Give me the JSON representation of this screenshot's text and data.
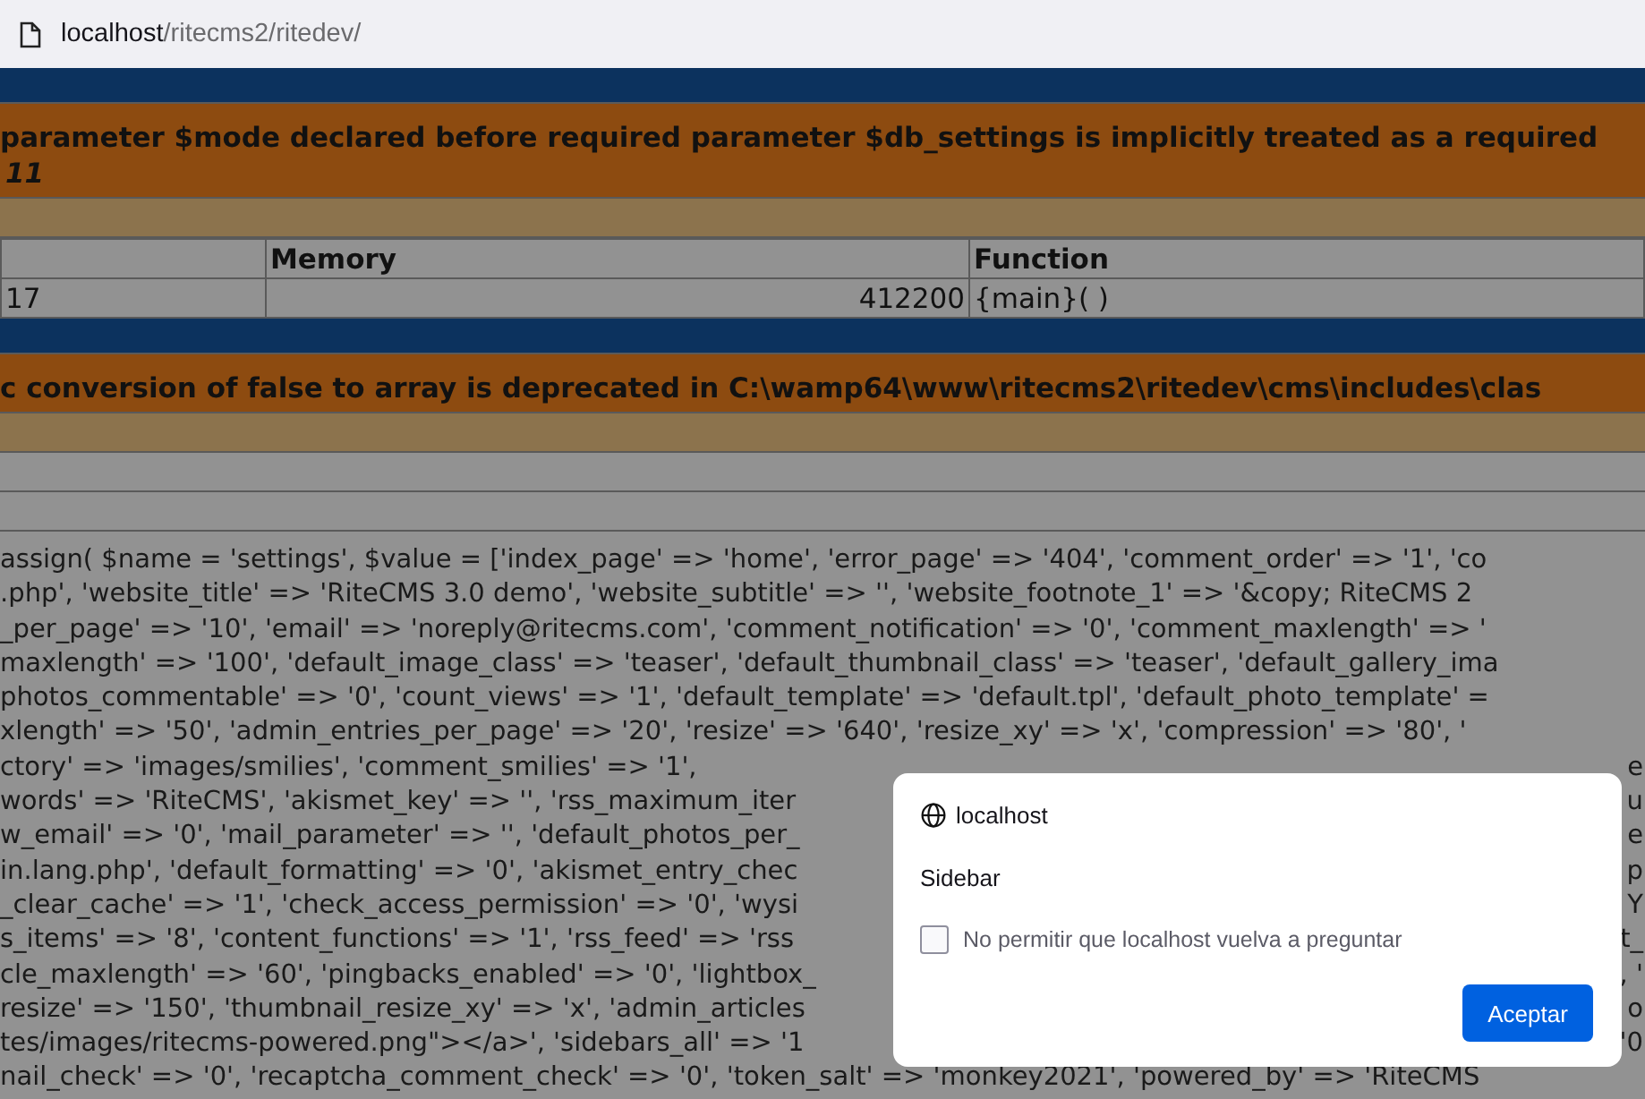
{
  "address_bar": {
    "host": "localhost",
    "path": "/ritecms2/ritedev/"
  },
  "errors": [
    {
      "message": "parameter $mode declared before required parameter $db_settings is implicitly treated as a required",
      "line_2": "11",
      "table": {
        "columns": [
          "Memory",
          "Function"
        ],
        "rows": [
          {
            "column_1": "17",
            "memory": "412200",
            "function": "{main}( )"
          }
        ]
      }
    },
    {
      "message": "c conversion of false to array is deprecated in C:\\wamp64\\www\\ritecms2\\ritedev\\cms\\includes\\clas"
    }
  ],
  "code_lines": [
    {
      "text": "assign( $name = 'settings', $value = ['index_page' => 'home', 'error_page' => '404', 'comment_order' => '1', 'co"
    },
    {
      "text": ".php', 'website_title' => 'RiteCMS 3.0 demo', 'website_subtitle' => '', 'website_footnote_1' => '&copy; RiteCMS 2"
    },
    {
      "text": "_per_page' => '10', 'email' => 'noreply@ritecms.com', 'comment_notification' => '0', 'comment_maxlength' => '"
    },
    {
      "text": "maxlength' => '100', 'default_image_class' => 'teaser', 'default_thumbnail_class' => 'teaser', 'default_gallery_ima"
    },
    {
      "text": "photos_commentable' => '0', 'count_views' => '1', 'default_template' => 'default.tpl', 'default_photo_template' ="
    },
    {
      "text": "xlength' => '50', 'admin_entries_per_page' => '20', 'resize' => '640', 'resize_xy' => 'x', 'compression' => '80', '"
    },
    {
      "text": "ctory' => 'images/smilies', 'comment_smilies' => '1',",
      "after": "e"
    },
    {
      "text": "words' => 'RiteCMS', 'akismet_key' => '', 'rss_maximum_iter",
      "after": "u"
    },
    {
      "text": "w_email' => '0', 'mail_parameter' => '', 'default_photos_per_",
      "after": "e"
    },
    {
      "text": "in.lang.php', 'default_formatting' => '0', 'akismet_entry_chec",
      "after": "p"
    },
    {
      "text": "_clear_cache' => '1', 'check_access_permission' => '0', 'wysi",
      "after": "Y"
    },
    {
      "text": "s_items' => '8', 'content_functions' => '1', 'rss_feed' => 'rss",
      "after": "t_"
    },
    {
      "text": "cle_maxlength' => '60', 'pingbacks_enabled' => '0', 'lightbox_",
      "after": ", '"
    },
    {
      "text": "resize' => '150', 'thumbnail_resize_xy' => 'x', 'admin_articles",
      "after": "o"
    },
    {
      "text": "tes/images/ritecms-powered.png\"></a>', 'sidebars_all' => '1",
      "after": "'0"
    },
    {
      "text": "nail_check' => '0', 'recaptcha_comment_check' => '0', 'token_salt' => 'monkey2021', 'powered_by' => 'RiteCMS"
    }
  ],
  "dialog": {
    "origin": "localhost",
    "message": "Sidebar",
    "checkbox": {
      "label": "No permitir que localhost vuelva a preguntar",
      "checked": false
    },
    "button": "Aceptar"
  }
}
